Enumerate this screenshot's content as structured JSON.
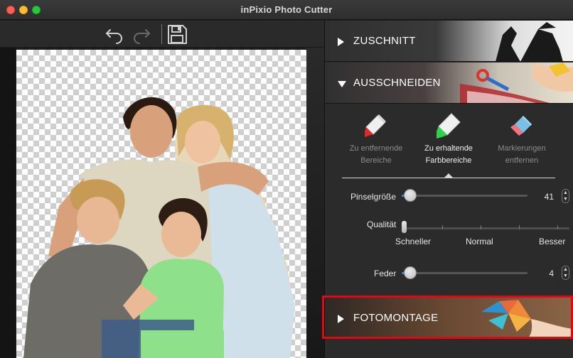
{
  "window": {
    "title": "inPixio Photo Cutter"
  },
  "toolbar": {
    "undo_icon": "undo-icon",
    "redo_icon": "redo-icon",
    "save_icon": "save-icon"
  },
  "canvas": {
    "background": "transparency-checkerboard"
  },
  "sections": {
    "zuschnitt": {
      "label": "ZUSCHNITT",
      "state": "collapsed"
    },
    "ausschneiden": {
      "label": "AUSSCHNEIDEN",
      "state": "expanded"
    },
    "fotomontage": {
      "label": "FOTOMONTAGE",
      "state": "collapsed"
    }
  },
  "tools": [
    {
      "line1": "Zu entfernende",
      "line2": "Bereiche",
      "icon": "red-marker-icon",
      "active": false
    },
    {
      "line1": "Zu erhaltende",
      "line2": "Farbbereiche",
      "icon": "green-marker-icon",
      "active": true
    },
    {
      "line1": "Markierungen",
      "line2": "entfernen",
      "icon": "eraser-icon",
      "active": false
    }
  ],
  "brush_size": {
    "label": "Pinselgröße",
    "value": "41",
    "fraction": 0.04
  },
  "quality": {
    "label": "Qualität",
    "options": [
      "Schneller",
      "Normal",
      "Besser"
    ],
    "selected": "Schneller"
  },
  "feather": {
    "label": "Feder",
    "value": "4",
    "fraction": 0.04
  },
  "colors": {
    "accent": "#3a7df0",
    "highlight": "#e30613",
    "marker_red": "#e02a2a",
    "marker_green": "#2fd24a"
  }
}
